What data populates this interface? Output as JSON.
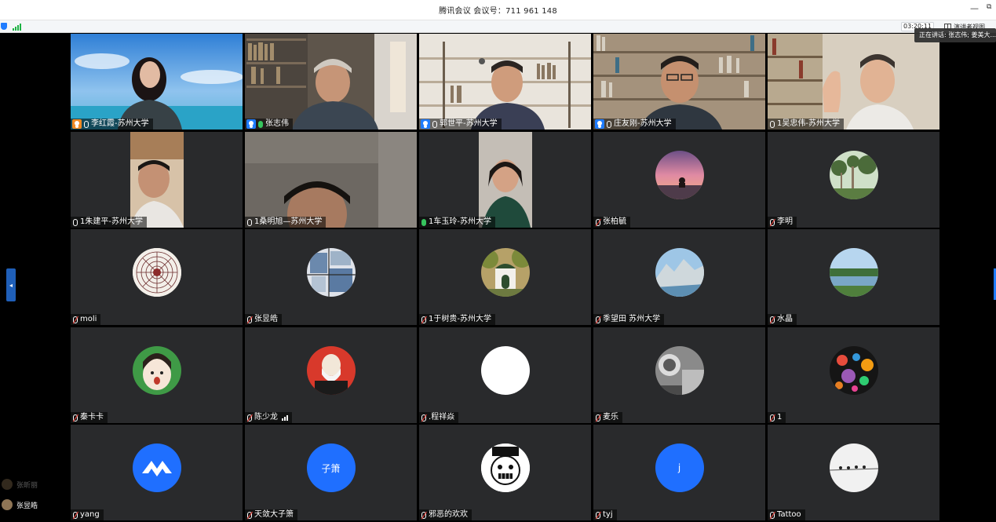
{
  "window": {
    "title": "腾讯会议  会议号：711 961 148",
    "minimize_icon": "—",
    "restore_icon": "⧉"
  },
  "toolbar": {
    "timer": "03:20:11",
    "view_button": "演讲者视图"
  },
  "speaking_tip": "正在讲话: 张志伟; 姜美大...",
  "participants": [
    {
      "name": "李红霞-苏州大学",
      "badge": "host-orange",
      "mic": "on-white"
    },
    {
      "name": "张志伟",
      "badge": "host",
      "mic": "on"
    },
    {
      "name": "郭世平-苏州大学",
      "badge": "host",
      "mic": "on-white"
    },
    {
      "name": "庄友刚-苏州大学",
      "badge": "host",
      "mic": "on-white"
    },
    {
      "name": "1吴忠伟-苏州大学",
      "badge": "",
      "mic": "on-white"
    },
    {
      "name": "1朱建平-苏州大学",
      "badge": "",
      "mic": "on-white"
    },
    {
      "name": "1桑明旭—苏州大学",
      "badge": "",
      "mic": "on-white"
    },
    {
      "name": "1车玉玲-苏州大学",
      "badge": "",
      "mic": "on"
    },
    {
      "name": "张柏毓",
      "badge": "",
      "mic": "off"
    },
    {
      "name": "李明",
      "badge": "",
      "mic": "off"
    },
    {
      "name": "moli",
      "badge": "",
      "mic": "off"
    },
    {
      "name": "张昱皓",
      "badge": "",
      "mic": "off"
    },
    {
      "name": "1于树贵-苏州大学",
      "badge": "",
      "mic": "off"
    },
    {
      "name": "季望田 苏州大学",
      "badge": "",
      "mic": "off"
    },
    {
      "name": "水晶",
      "badge": "",
      "mic": "off"
    },
    {
      "name": "秦卡卡",
      "badge": "",
      "mic": "off"
    },
    {
      "name": "陈少龙",
      "badge": "",
      "mic": "off"
    },
    {
      "name": ".程祥焱",
      "badge": "",
      "mic": "off"
    },
    {
      "name": "麦乐",
      "badge": "",
      "mic": "off"
    },
    {
      "name": "1",
      "badge": "",
      "mic": "off"
    },
    {
      "name": "yang",
      "badge": "",
      "mic": "off"
    },
    {
      "name": "天敛大子箫",
      "badge": "",
      "mic": "off"
    },
    {
      "name": "邪恶的欢欢",
      "badge": "",
      "mic": "off"
    },
    {
      "name": "tyj",
      "badge": "",
      "mic": "off"
    },
    {
      "name": "Tattoo",
      "badge": "",
      "mic": "off"
    }
  ],
  "avatars": {
    "zixiao_text": "子箫",
    "tyj_text": "j"
  },
  "waiting_list": [
    {
      "name": "张昕丽"
    },
    {
      "name": "张昱皓"
    }
  ],
  "colors": {
    "accent": "#1f7cff",
    "speaking_border": "#27a55a",
    "tile_bg": "#292a2c",
    "mic_muted": "#f3433c"
  }
}
